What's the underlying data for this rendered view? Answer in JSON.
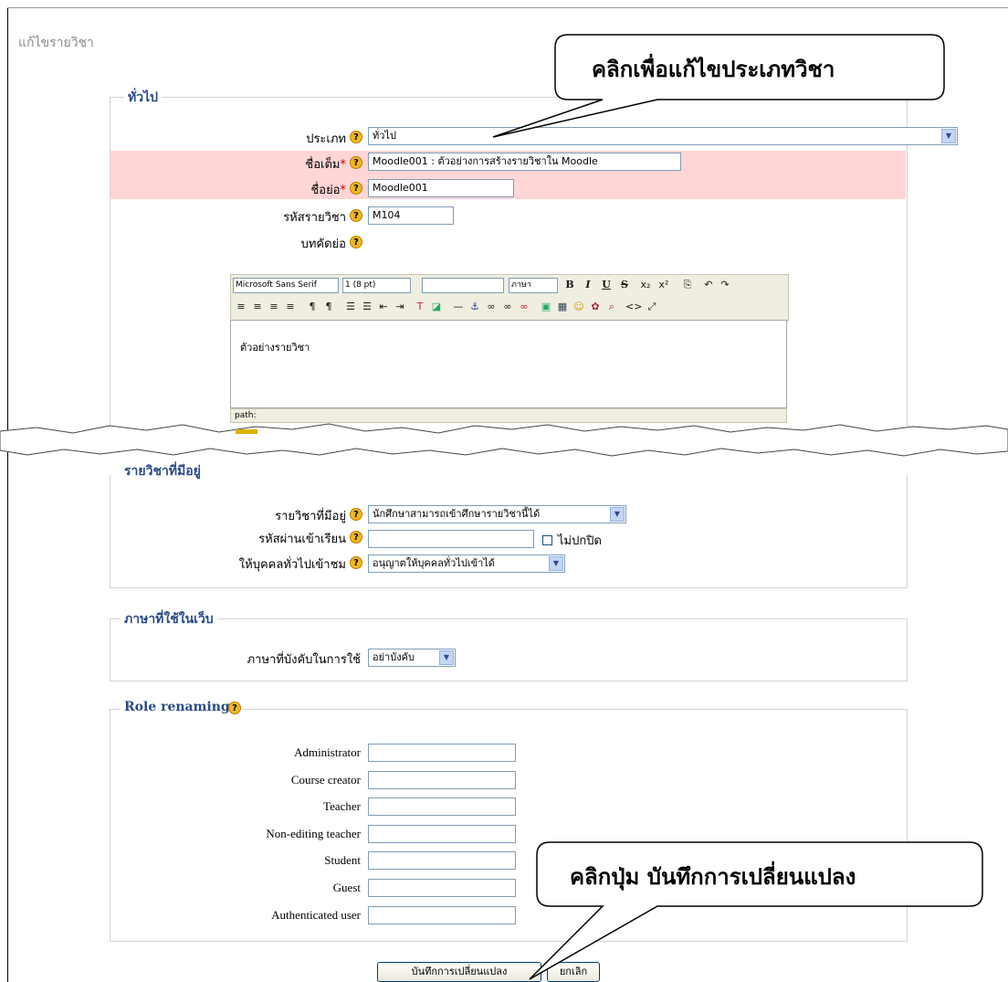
{
  "page_title": "แก้ไขรายวิชา",
  "callouts": {
    "top": "คลิกเพื่อแก้ไขประเภทวิชา",
    "bottom": "คลิกปุ่ม บันทึกการเปลี่ยนแปลง"
  },
  "general": {
    "legend": "ทั่วไป",
    "category_label": "ประเภท",
    "category_value": "ทั่วไป",
    "fullname_label": "ชื่อเต็ม",
    "fullname_value": "Moodle001 : ตัวอย่างการสร้างรายวิชาใน Moodle",
    "shortname_label": "ชื่อย่อ",
    "shortname_value": "Moodle001",
    "idnumber_label": "รหัสรายวิชา",
    "idnumber_value": "M104",
    "summary_label": "บทคัดย่อ",
    "required_mark": "*",
    "help_glyph": "?"
  },
  "editor": {
    "font_family": "Microsoft Sans Serif",
    "font_size": "1 (8 pt)",
    "heading": "",
    "language": "ภาษา",
    "content": "ตัวอย่างรายวิชา",
    "path_label": "path:"
  },
  "availability": {
    "legend": "รายวิชาที่มีอยู่",
    "available_label": "รายวิชาที่มีอยู่",
    "available_value": "นักศึกษาสามารถเข้าศึกษารายวิชานี้ได้",
    "enrolkey_label": "รหัสผ่านเข้าเรียน",
    "enrolkey_value": "",
    "unmask_label": "ไม่ปกปิด",
    "guest_label": "ให้บุคคลทั่วไปเข้าชม",
    "guest_value": "อนุญาตให้บุคคลทั่วไปเข้าได้"
  },
  "language": {
    "legend": "ภาษาที่ใช้ในเว็บ",
    "force_label": "ภาษาที่บังคับในการใช้",
    "force_value": "อย่าบังคับ"
  },
  "roles": {
    "legend": "Role renaming",
    "items": [
      {
        "label": "Administrator",
        "value": ""
      },
      {
        "label": "Course creator",
        "value": ""
      },
      {
        "label": "Teacher",
        "value": ""
      },
      {
        "label": "Non-editing teacher",
        "value": ""
      },
      {
        "label": "Student",
        "value": ""
      },
      {
        "label": "Guest",
        "value": ""
      },
      {
        "label": "Authenticated user",
        "value": ""
      }
    ]
  },
  "buttons": {
    "save": "บันทึกการเปลี่ยนแปลง",
    "cancel": "ยกเลิก"
  }
}
